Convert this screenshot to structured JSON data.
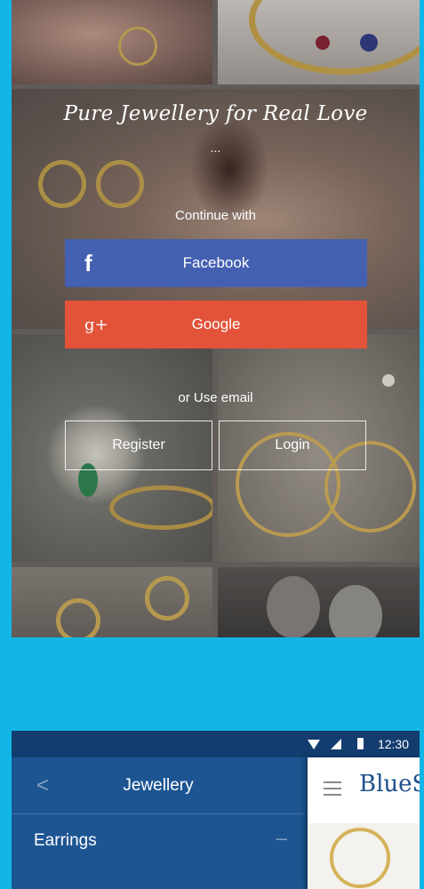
{
  "login_screen": {
    "tagline": "Pure Jewellery for Real Love",
    "tagline_ellipsis": "...",
    "continue_with": "Continue with",
    "facebook_label": "Facebook",
    "facebook_icon": "f",
    "google_label": "Google",
    "google_icon": "g+",
    "or_use_email": "or Use email",
    "register_label": "Register",
    "login_label": "Login",
    "colors": {
      "facebook": "#4460b0",
      "google": "#e2533a"
    }
  },
  "menu_screen": {
    "status_bar": {
      "time": "12:30"
    },
    "drawer": {
      "title": "Jewellery",
      "back_icon": "<",
      "items": [
        {
          "label": "Earrings",
          "toggle": "–"
        }
      ]
    },
    "panel": {
      "brand": "BlueS"
    }
  },
  "background_color": "#11b6e6"
}
